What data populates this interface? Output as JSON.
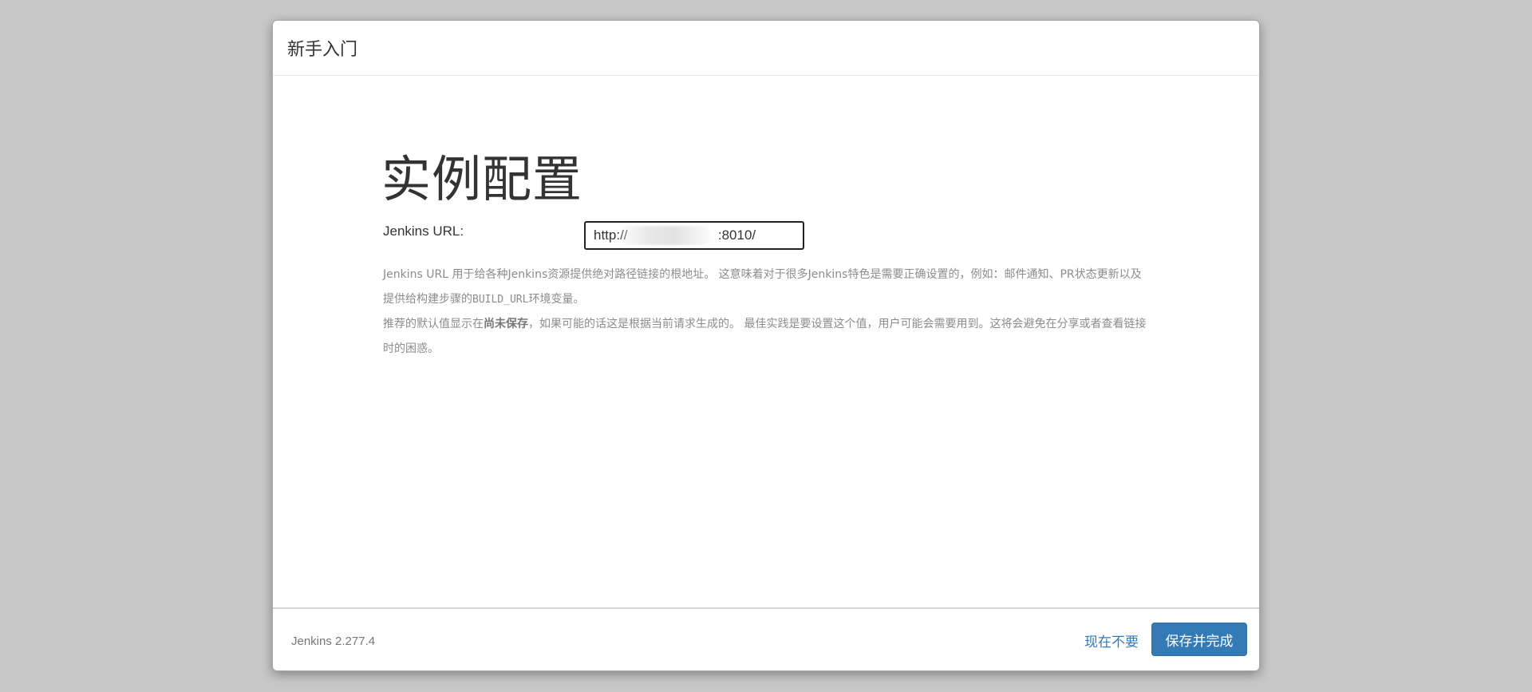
{
  "dialog": {
    "title": "新手入门"
  },
  "main": {
    "heading": "实例配置",
    "url_label": "Jenkins URL:",
    "url_value": "http://                        :8010/",
    "help": {
      "line1_a": "Jenkins URL 用于给各种Jenkins资源提供绝对路径链接的根地址。 这意味着对于很多Jenkins特色是需要正确设置的，例如：邮件通知、PR状态更新以及提供给构建步骤的",
      "line1_code": "BUILD_URL",
      "line1_b": "环境变量。",
      "line2_a": "推荐的默认值显示在",
      "line2_strong": "尚未保存",
      "line2_b": "，如果可能的话这是根据当前请求生成的。 最佳实践是要设置这个值，用户可能会需要用到。这将会避免在分享或者查看链接时的困惑。"
    }
  },
  "footer": {
    "version": "Jenkins 2.277.4",
    "skip_label": "现在不要",
    "save_label": "保存并完成"
  },
  "colors": {
    "primary": "#337ab7",
    "backdrop": "#c8c8c8"
  }
}
